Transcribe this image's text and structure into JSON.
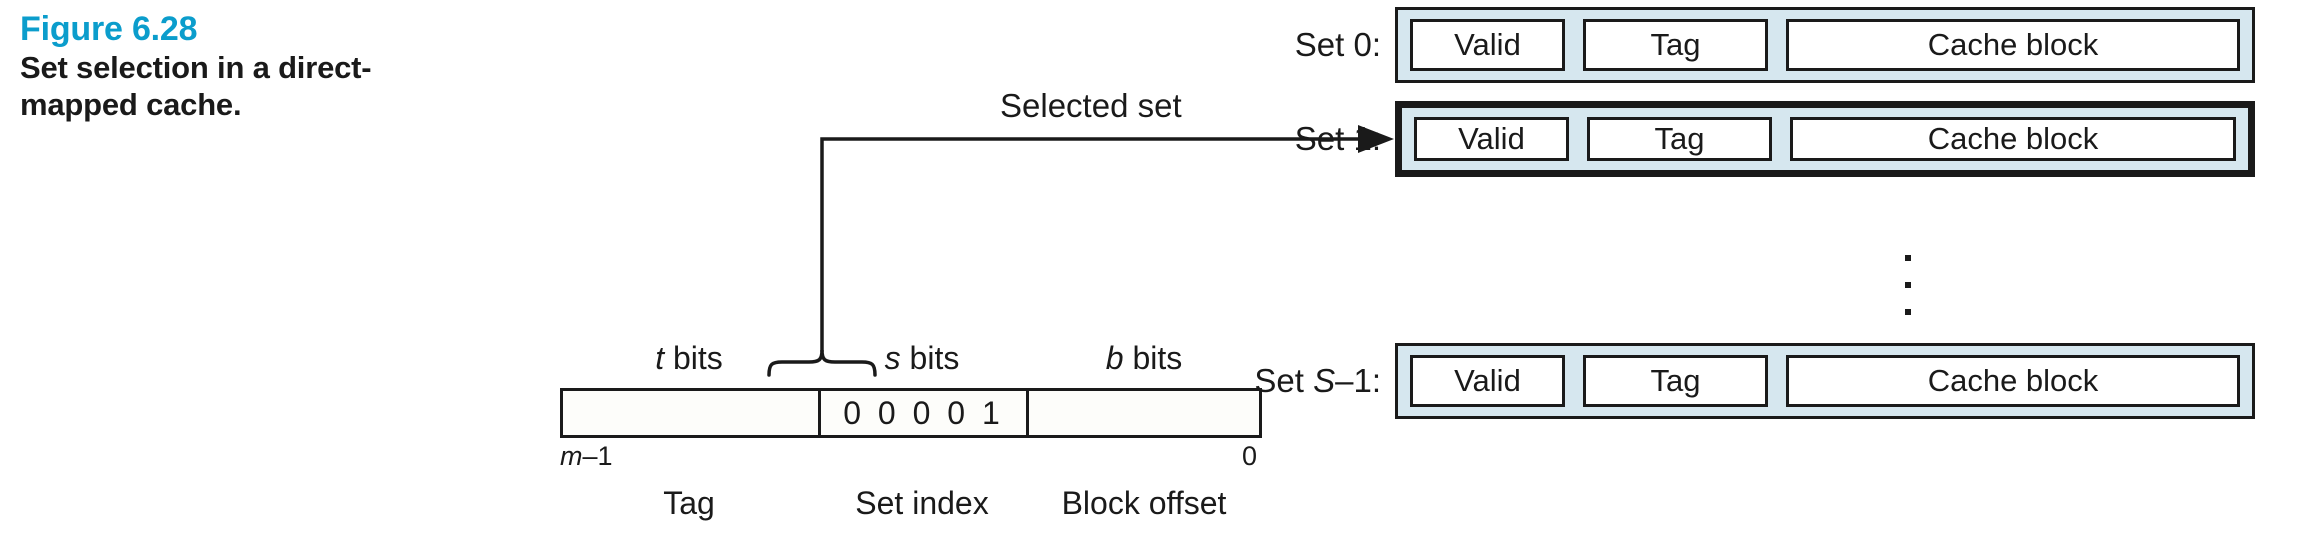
{
  "caption": {
    "figure_number": "Figure 6.28",
    "title": "Set selection in a direct-mapped cache.",
    "accent_color": "#0b9dcc"
  },
  "colors": {
    "set_fill": "#d6e7ef",
    "cell_fill": "#ffffff",
    "stroke": "#1a1a1a",
    "background": "#ffffff"
  },
  "cache": {
    "column_headers": [
      "Valid",
      "Tag",
      "Cache block"
    ],
    "rows": [
      {
        "label_prefix": "Set 0:",
        "label_plain": "Set 0:",
        "selected": false,
        "cells": [
          "Valid",
          "Tag",
          "Cache block"
        ]
      },
      {
        "label_prefix": "Set 1:",
        "label_plain": "Set 1:",
        "selected": true,
        "cells": [
          "Valid",
          "Tag",
          "Cache block"
        ]
      },
      {
        "label_prefix": "Set S–1:",
        "label_plain": "Set S–1:",
        "selected": false,
        "cells": [
          "Valid",
          "Tag",
          "Cache block"
        ]
      }
    ],
    "ellipsis_dots": 3
  },
  "annotation": {
    "selected_set_label": "Selected set"
  },
  "address": {
    "bit_labels": {
      "tag": "bits",
      "set": "bits",
      "block": "bits"
    },
    "bit_symbols": {
      "tag": "t",
      "set": "s",
      "block": "b"
    },
    "field_values": {
      "tag": "",
      "set": "0 0 0 0 1",
      "block": ""
    },
    "endpoints": {
      "left_symbol": "m",
      "left_rest": "–1",
      "right": "0"
    },
    "field_names": {
      "tag": "Tag",
      "set": "Set index",
      "block": "Block offset"
    }
  }
}
